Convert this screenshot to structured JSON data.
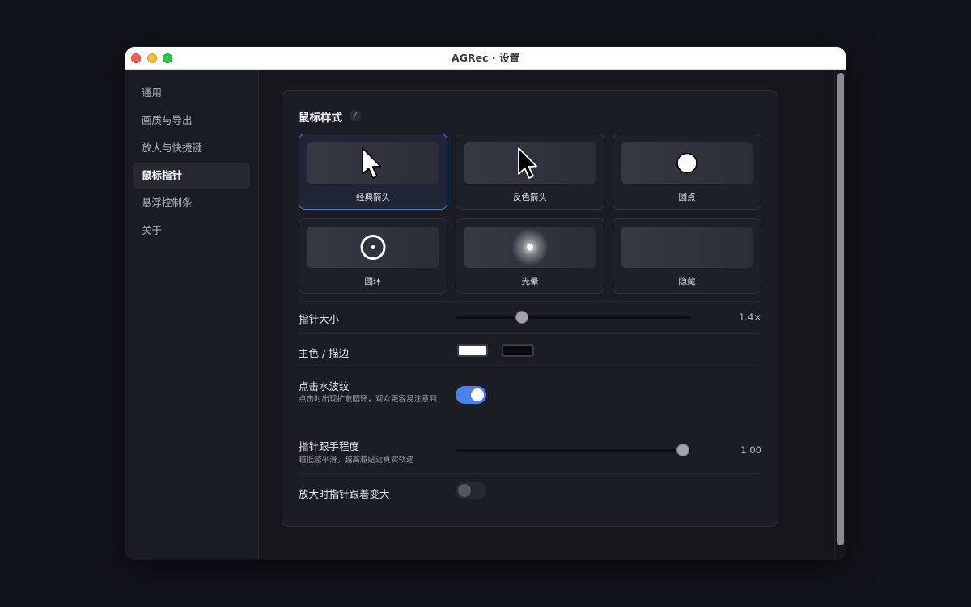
{
  "window": {
    "title": "AGRec · 设置"
  },
  "sidebar": {
    "items": [
      {
        "label": "通用",
        "active": false
      },
      {
        "label": "画质与导出",
        "active": false
      },
      {
        "label": "放大与快捷键",
        "active": false
      },
      {
        "label": "鼠标指针",
        "active": true
      },
      {
        "label": "悬浮控制条",
        "active": false
      },
      {
        "label": "关于",
        "active": false
      }
    ]
  },
  "section": {
    "title": "鼠标样式",
    "help": "?"
  },
  "styles": [
    {
      "label": "经典箭头",
      "icon": "arrow-cursor-icon",
      "selected": true
    },
    {
      "label": "反色箭头",
      "icon": "inverted-arrow-cursor-icon",
      "selected": false
    },
    {
      "label": "圆点",
      "icon": "dot-cursor-icon",
      "selected": false
    },
    {
      "label": "圆环",
      "icon": "ring-cursor-icon",
      "selected": false
    },
    {
      "label": "光晕",
      "icon": "halo-cursor-icon",
      "selected": false
    },
    {
      "label": "隐藏",
      "icon": "",
      "selected": false
    }
  ],
  "settings": {
    "size": {
      "label": "指针大小",
      "value": 0.28,
      "value_text": "1.4×"
    },
    "color": {
      "label": "主色 / 描边",
      "primary": "#ffffff",
      "stroke": "#0b0b0c"
    },
    "ripple": {
      "label": "点击水波纹",
      "desc": "点击时出现扩散圆环，观众更容易注意到",
      "enabled": true
    },
    "follow": {
      "label": "指针跟手程度",
      "desc": "越低越平滑，越高越贴近真实轨迹",
      "value": 1.0,
      "value_text": "1.00"
    },
    "zoom_follow": {
      "label": "放大时指针跟着变大",
      "enabled": false
    }
  },
  "colors": {
    "accent": "#4a80ea",
    "selected_border": "#4c7bd9"
  }
}
